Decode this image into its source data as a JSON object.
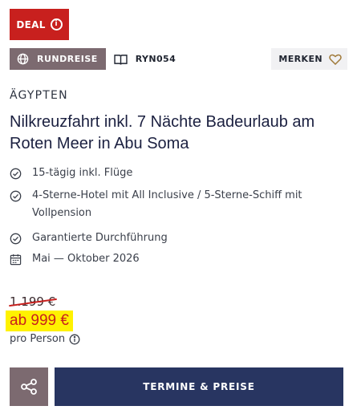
{
  "badge": {
    "label": "DEAL",
    "color": "#c8201e"
  },
  "tags": {
    "type_label": "RUNDREISE",
    "type_icon": "globe-icon",
    "code": "RYN054",
    "code_icon": "book-icon"
  },
  "favorite": {
    "label": "MERKEN",
    "icon": "heart-icon"
  },
  "offer": {
    "country": "ÄGYPTEN",
    "title": "Nilkreuzfahrt inkl. 7 Nächte Badeurlaub am Roten Meer in Abu Soma"
  },
  "features": [
    {
      "icon": "check-circle-icon",
      "text": "15-tägig inkl. Flüge"
    },
    {
      "icon": "check-circle-icon",
      "text": "4-Sterne-Hotel mit All Inclusive / 5-Sterne-Schiff mit Vollpension"
    },
    {
      "icon": "check-circle-icon",
      "text": "Garantierte Durchführung"
    },
    {
      "icon": "calendar-icon",
      "text": "Mai — Oktober 2026"
    }
  ],
  "price": {
    "old": "1.199 €",
    "current": "ab 999 €",
    "note": "pro Person",
    "highlight_color": "#fff200",
    "price_color": "#c8201e"
  },
  "actions": {
    "share_icon": "share-icon",
    "cta_label": "TERMINE & PREISE",
    "cta_color": "#283561"
  }
}
